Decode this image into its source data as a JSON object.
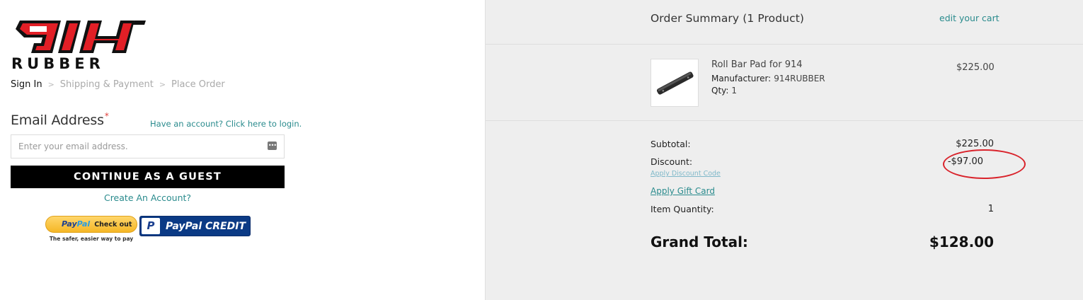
{
  "brand": {
    "logo_text_top": "914",
    "logo_text_bottom": "RUBBER",
    "logo_color": "#e21f26"
  },
  "breadcrumb": [
    {
      "label": "Sign In",
      "active": true
    },
    {
      "label": "Shipping & Payment",
      "active": false
    },
    {
      "label": "Place Order",
      "active": false
    }
  ],
  "breadcrumb_sep": ">",
  "sign_in": {
    "email_label": "Email Address",
    "required_mark": "*",
    "login_link": "Have an account? Click here to login.",
    "email_placeholder": "Enter your email address.",
    "email_value": "",
    "guest_button": "CONTINUE AS A GUEST",
    "create_account_link": "Create An Account?"
  },
  "paypal": {
    "checkout_pp": "Pay",
    "checkout_pal": "Pal",
    "checkout_label": "Check out",
    "tagline": "The safer, easier way to pay",
    "credit_label": "PayPal CREDIT",
    "credit_icon": "P"
  },
  "summary": {
    "title": "Order Summary (1 Product)",
    "edit_cart": "edit your cart",
    "product": {
      "name": "Roll Bar Pad for 914",
      "manufacturer_label": "Manufacturer:",
      "manufacturer": "914RUBBER",
      "qty_label": "Qty:",
      "qty": "1",
      "price": "$225.00"
    },
    "subtotal_label": "Subtotal:",
    "subtotal": "$225.00",
    "discount_label": "Discount:",
    "discount": "-$97.00",
    "apply_discount": "Apply Discount Code",
    "apply_gift": "Apply Gift Card",
    "item_qty_label": "Item Quantity:",
    "item_qty": "1",
    "grand_total_label": "Grand Total:",
    "grand_total": "$128.00",
    "highlight_color": "#d9232b"
  }
}
